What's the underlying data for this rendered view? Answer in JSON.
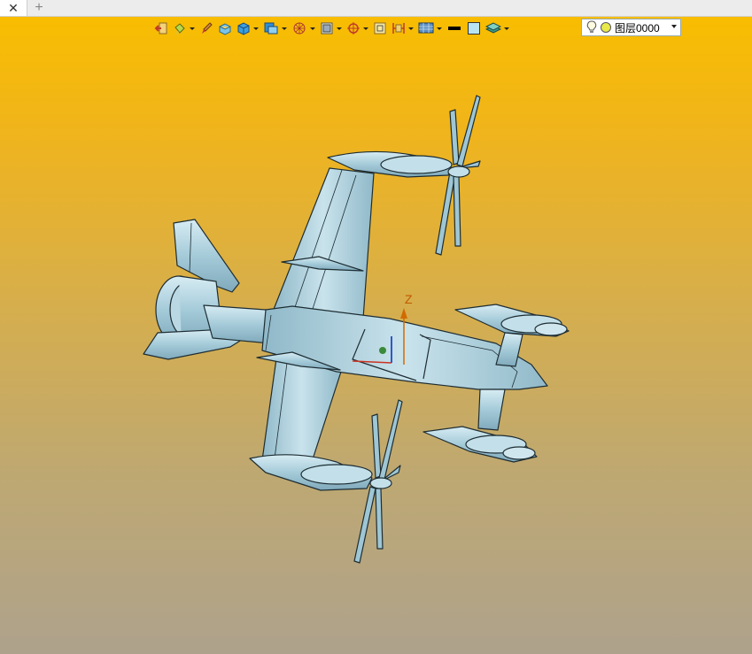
{
  "tabs": {
    "close_glyph": "✕",
    "new_glyph": "+"
  },
  "toolbar": {
    "icons": [
      {
        "name": "exit-icon",
        "dropdown": false
      },
      {
        "name": "paint-bucket-icon",
        "dropdown": true
      },
      {
        "name": "brush-icon",
        "dropdown": false
      },
      {
        "name": "box-material-icon",
        "dropdown": false
      },
      {
        "name": "shaded-cube-icon",
        "dropdown": true
      },
      {
        "name": "render-style-icon",
        "dropdown": true
      },
      {
        "name": "wireframe-sphere-icon",
        "dropdown": true
      },
      {
        "name": "image-frame-icon",
        "dropdown": true
      },
      {
        "name": "snap-target-icon",
        "dropdown": true
      },
      {
        "name": "select-box-icon",
        "dropdown": false
      },
      {
        "name": "dimension-icon",
        "dropdown": true
      },
      {
        "name": "display-grid-icon",
        "dropdown": true
      },
      {
        "name": "line-color-icon",
        "dropdown": false
      },
      {
        "name": "fill-color-icon",
        "dropdown": false
      },
      {
        "name": "layer-stack-icon",
        "dropdown": true
      }
    ],
    "layer": {
      "value": "图层0000"
    }
  },
  "viewport": {
    "axis_label": "Z",
    "colors": {
      "top": "#f8bd00",
      "bottom": "#aea28c",
      "model": "#a8cfdd"
    }
  }
}
